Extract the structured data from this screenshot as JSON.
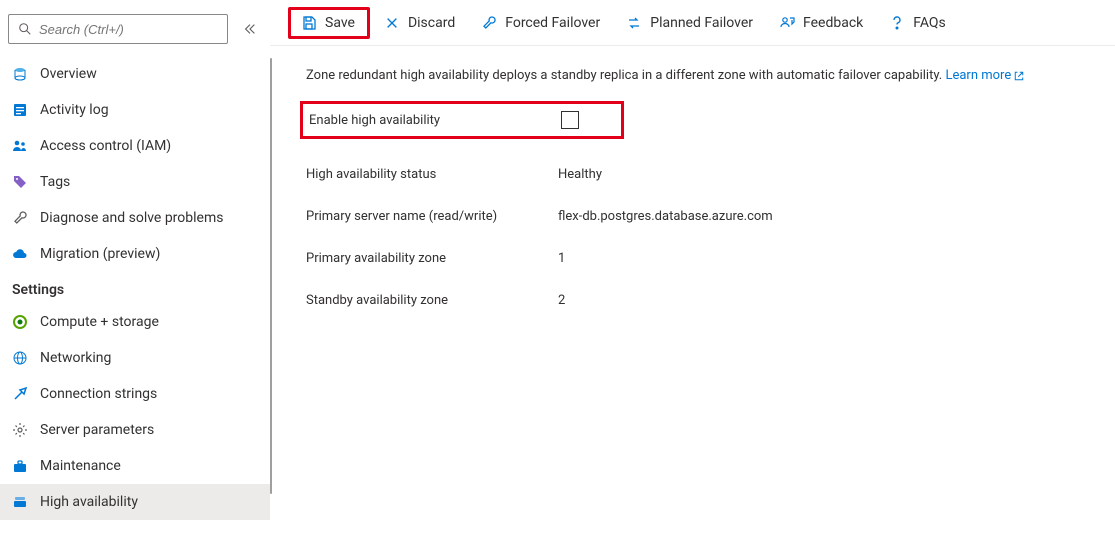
{
  "search": {
    "placeholder": "Search (Ctrl+/)"
  },
  "sidebar": {
    "items": [
      {
        "label": "Overview"
      },
      {
        "label": "Activity log"
      },
      {
        "label": "Access control (IAM)"
      },
      {
        "label": "Tags"
      },
      {
        "label": "Diagnose and solve problems"
      },
      {
        "label": "Migration (preview)"
      }
    ],
    "settings_header": "Settings",
    "settings_items": [
      {
        "label": "Compute + storage"
      },
      {
        "label": "Networking"
      },
      {
        "label": "Connection strings"
      },
      {
        "label": "Server parameters"
      },
      {
        "label": "Maintenance"
      },
      {
        "label": "High availability"
      }
    ]
  },
  "toolbar": {
    "save": "Save",
    "discard": "Discard",
    "forced_failover": "Forced Failover",
    "planned_failover": "Planned Failover",
    "feedback": "Feedback",
    "faqs": "FAQs"
  },
  "main": {
    "desc": "Zone redundant high availability deploys a standby replica in a different zone with automatic failover capability.",
    "learn_more": "Learn more",
    "enable_label": "Enable high availability",
    "rows": [
      {
        "label": "High availability status",
        "value": "Healthy"
      },
      {
        "label": "Primary server name (read/write)",
        "value": "flex-db.postgres.database.azure.com"
      },
      {
        "label": "Primary availability zone",
        "value": "1"
      },
      {
        "label": "Standby availability zone",
        "value": "2"
      }
    ]
  }
}
